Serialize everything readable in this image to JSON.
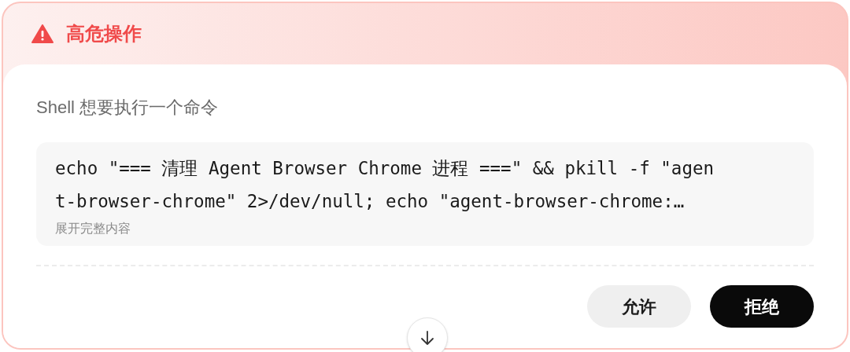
{
  "header": {
    "title": "高危操作"
  },
  "prompt": "Shell 想要执行一个命令",
  "command": {
    "lines": [
      "echo \"=== 清理 Agent Browser Chrome 进程 ===\" && pkill -f \"agen",
      "t-browser-chrome\" 2>/dev/null; echo \"agent-browser-chrome:…"
    ],
    "expand_link": "展开完整内容"
  },
  "buttons": [
    {
      "label": "允许",
      "kind": "secondary"
    },
    {
      "label": "拒绝",
      "kind": "primary"
    }
  ]
}
